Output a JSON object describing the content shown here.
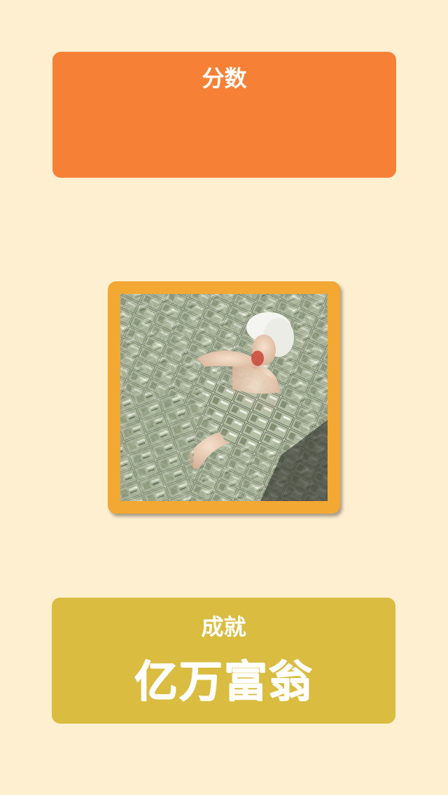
{
  "score": {
    "title": "分数",
    "value": ""
  },
  "photo": {
    "description_icon": "money-bath-photo"
  },
  "achievement": {
    "label": "成就",
    "value": "亿万富翁"
  },
  "colors": {
    "background": "#FEEFD0",
    "score_card": "#F68136",
    "photo_frame": "#F3A833",
    "achievement_card": "#D9BC40",
    "text": "#FFFFFF"
  }
}
